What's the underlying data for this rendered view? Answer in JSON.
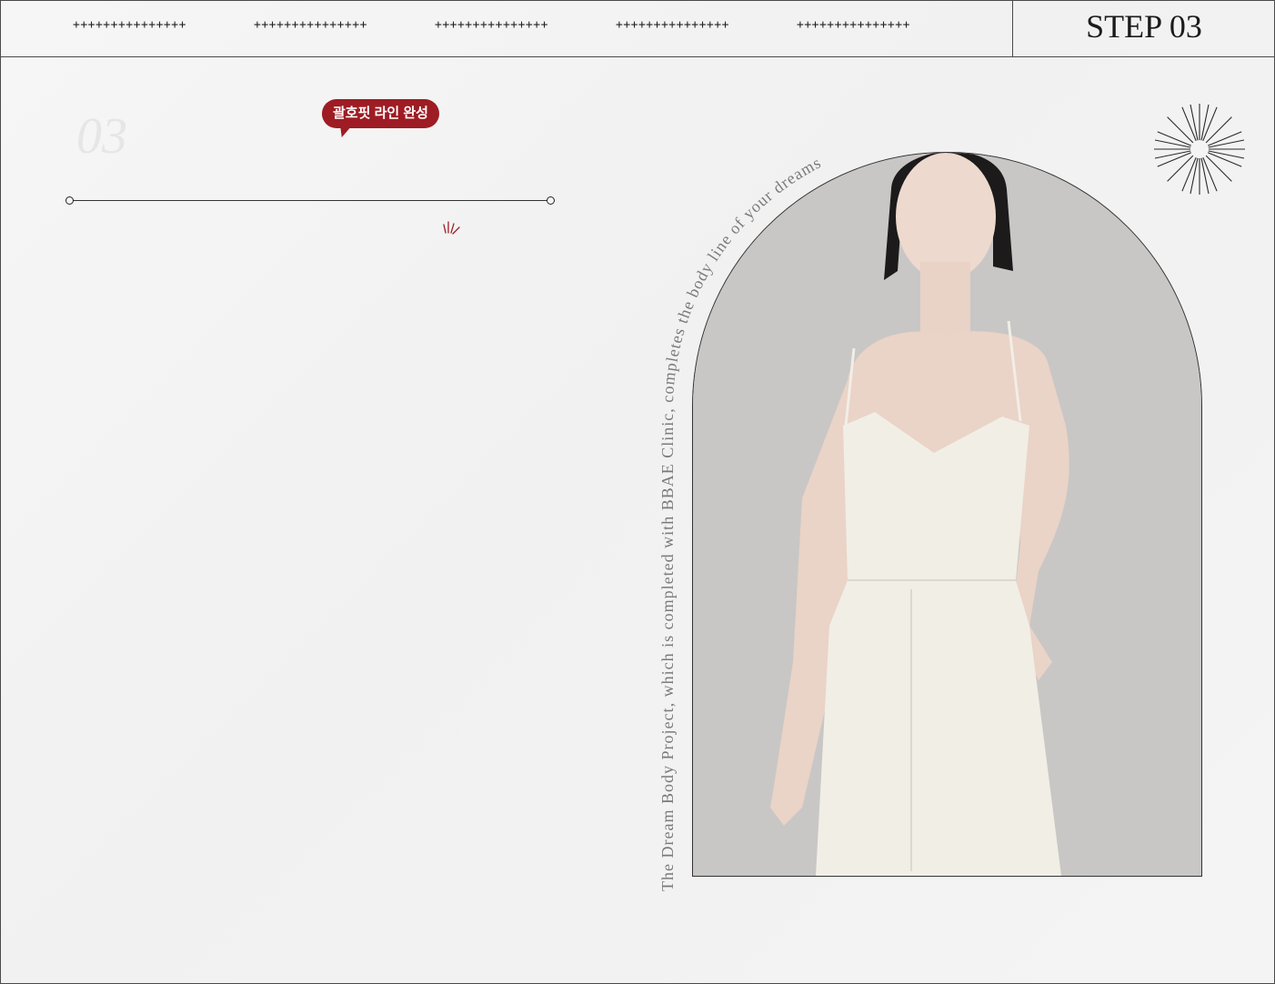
{
  "header": {
    "plus_groups": [
      "+++++++++++++++",
      "+++++++++++++++",
      "+++++++++++++++",
      "+++++++++++++++",
      "+++++++++++++++"
    ],
    "step_label": "STEP 03"
  },
  "section": {
    "number": "03",
    "badge": "괄호핏 라인 완성"
  },
  "arch_text": {
    "line": "The Dream Body Project, which is completed with BBAE Clinic, completes the body line of your dreams "
  },
  "colors": {
    "accent": "#9e1c24",
    "line": "#333333"
  }
}
